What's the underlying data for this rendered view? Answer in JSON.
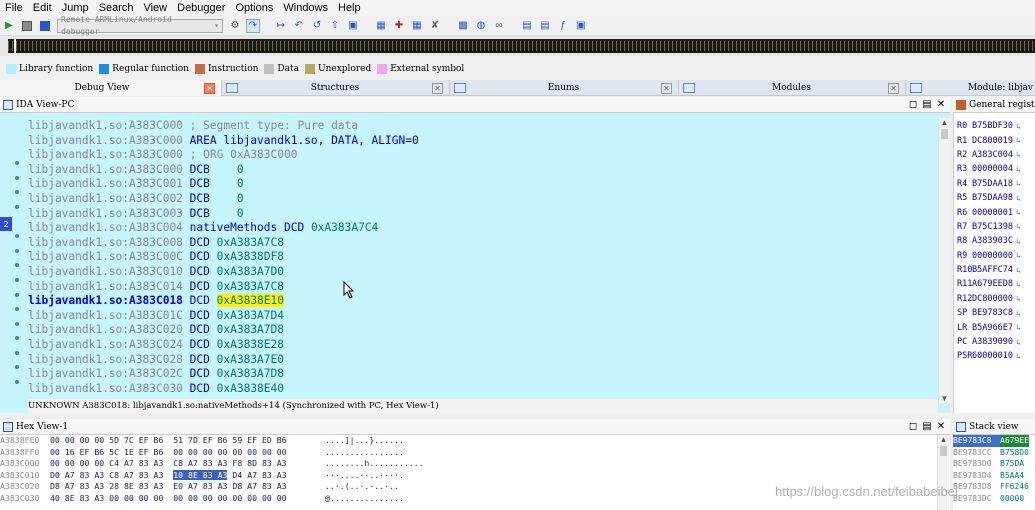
{
  "menu": [
    "File",
    "Edit",
    "Jump",
    "Search",
    "View",
    "Debugger",
    "Options",
    "Windows",
    "Help"
  ],
  "toolbar": {
    "debugger_select": "Remote ARMLinux/Android debugger"
  },
  "legend": [
    {
      "label": "Library function",
      "color": "#aeeeff"
    },
    {
      "label": "Regular function",
      "color": "#1e8fe0"
    },
    {
      "label": "Instruction",
      "color": "#c26a44"
    },
    {
      "label": "Data",
      "color": "#c0c0c0"
    },
    {
      "label": "Unexplored",
      "color": "#b9a860"
    },
    {
      "label": "External symbol",
      "color": "#f6a4ef"
    }
  ],
  "tabs": [
    "Debug View",
    "Structures",
    "Enums",
    "Modules",
    "Module: libjav"
  ],
  "ida_view": {
    "title": "IDA View-PC",
    "marker": "2",
    "lines": [
      {
        "addr": "libjavandk1.so:A383C000",
        "op": "",
        "arg": "; Segment type: Pure data",
        "kind": "comment"
      },
      {
        "addr": "libjavandk1.so:A383C000",
        "op": "AREA",
        "arg": "libjavandk1.so, DATA, ALIGN=0",
        "kind": "kw"
      },
      {
        "addr": "libjavandk1.so:A383C000",
        "op": "",
        "arg": "; ORG 0xA383C000",
        "kind": "comment"
      },
      {
        "addr": "libjavandk1.so:A383C000",
        "op": "DCB",
        "arg": "   0",
        "kind": "data"
      },
      {
        "addr": "libjavandk1.so:A383C001",
        "op": "DCB",
        "arg": "   0",
        "kind": "data"
      },
      {
        "addr": "libjavandk1.so:A383C002",
        "op": "DCB",
        "arg": "   0",
        "kind": "data"
      },
      {
        "addr": "libjavandk1.so:A383C003",
        "op": "DCB",
        "arg": "   0",
        "kind": "data"
      },
      {
        "addr": "libjavandk1.so:A383C004",
        "op": "nativeMethods DCD",
        "arg": "0xA383A7C4",
        "kind": "data"
      },
      {
        "addr": "libjavandk1.so:A383C008",
        "op": "DCD",
        "arg": "0xA383A7C8",
        "kind": "data"
      },
      {
        "addr": "libjavandk1.so:A383C00C",
        "op": "DCD",
        "arg": "0xA3838DF8",
        "kind": "data"
      },
      {
        "addr": "libjavandk1.so:A383C010",
        "op": "DCD",
        "arg": "0xA383A7D0",
        "kind": "data"
      },
      {
        "addr": "libjavandk1.so:A383C014",
        "op": "DCD",
        "arg": "0xA383A7C8",
        "kind": "data"
      },
      {
        "addr": "libjavandk1.so:A383C018",
        "op": "DCD",
        "arg": "0xA3838E10",
        "kind": "current"
      },
      {
        "addr": "libjavandk1.so:A383C01C",
        "op": "DCD",
        "arg": "0xA383A7D4",
        "kind": "data"
      },
      {
        "addr": "libjavandk1.so:A383C020",
        "op": "DCD",
        "arg": "0xA383A7D8",
        "kind": "data"
      },
      {
        "addr": "libjavandk1.so:A383C024",
        "op": "DCD",
        "arg": "0xA3838E28",
        "kind": "data"
      },
      {
        "addr": "libjavandk1.so:A383C028",
        "op": "DCD",
        "arg": "0xA383A7E0",
        "kind": "data"
      },
      {
        "addr": "libjavandk1.so:A383C02C",
        "op": "DCD",
        "arg": "0xA383A7D8",
        "kind": "data"
      },
      {
        "addr": "libjavandk1.so:A383C030",
        "op": "DCD",
        "arg": "0xA3838E40",
        "kind": "data"
      }
    ],
    "status": "UNKNOWN A383C018: libjavandk1.so:nativeMethods+14 (Synchronized with PC, Hex View-1)"
  },
  "registers": {
    "title": "General regist",
    "items": [
      {
        "name": "R0",
        "value": "B75BDF30"
      },
      {
        "name": "R1",
        "value": "DC800019"
      },
      {
        "name": "R2",
        "value": "A383C004"
      },
      {
        "name": "R3",
        "value": "00000004"
      },
      {
        "name": "R4",
        "value": "B75DAA18"
      },
      {
        "name": "R5",
        "value": "B75DAA98"
      },
      {
        "name": "R6",
        "value": "00000001"
      },
      {
        "name": "R7",
        "value": "B75C1398"
      },
      {
        "name": "R8",
        "value": "A383903C"
      },
      {
        "name": "R9",
        "value": "00000000"
      },
      {
        "name": "R10",
        "value": "B5AFFC74"
      },
      {
        "name": "R11",
        "value": "A679EED8"
      },
      {
        "name": "R12",
        "value": "DC800000"
      },
      {
        "name": "SP",
        "value": "BE9783C8"
      },
      {
        "name": "LR",
        "value": "B5A966E7"
      },
      {
        "name": "PC",
        "value": "A3839090"
      },
      {
        "name": "PSR",
        "value": "60000010"
      }
    ]
  },
  "hex_view": {
    "title": "Hex View-1",
    "rows": [
      {
        "addr": "A3838FE0",
        "b1": "00 00 00 00 5D 7C EF B6",
        "b2": "51 7D EF B6 59 EF ED B6",
        "asc": "....]|...}......"
      },
      {
        "addr": "A3838FF0",
        "b1": "00 16 EF B6 5C 1E EF B6",
        "b2": "00 00 00 00 00 00 00 00",
        "asc": "................"
      },
      {
        "addr": "A383C000",
        "b1": "00 00 00 00 C4 A7 83 A3",
        "b2": "C8 A7 83 A3 F8 8D 83 A3",
        "asc": "........h...........",
        "sel": ""
      },
      {
        "addr": "A383C010",
        "b1": "D0 A7 83 A3 C8 A7 83 A3",
        "b2": "D4 A7 83 A3",
        "sel": "10 8E 83 A3",
        "asc": "···....··..····."
      },
      {
        "addr": "A383C020",
        "b1": "D8 A7 83 A3 28 8E 83 A3",
        "b2": "E0 A7 83 A3 D8 A7 83 A3",
        "asc": "..·.(..·.·..·.."
      },
      {
        "addr": "A383C030",
        "b1": "40 8E 83 A3 00 00 00 00",
        "b2": "00 00 00 00 00 00 00 00",
        "asc": "@..............."
      }
    ]
  },
  "stack": {
    "title": "Stack view",
    "rows": [
      {
        "addr": "BE9783C8",
        "value": "A679EE"
      },
      {
        "addr": "BE9783CC",
        "value": "B758D0"
      },
      {
        "addr": "BE9783D0",
        "value": "B75DA"
      },
      {
        "addr": "BE9783D4",
        "value": "B5AA4"
      },
      {
        "addr": "BE9783D8",
        "value": "FF6246"
      },
      {
        "addr": "BE9783DC",
        "value": "00000"
      }
    ]
  },
  "watermark": "https://blog.csdn.net/feibabeibei"
}
